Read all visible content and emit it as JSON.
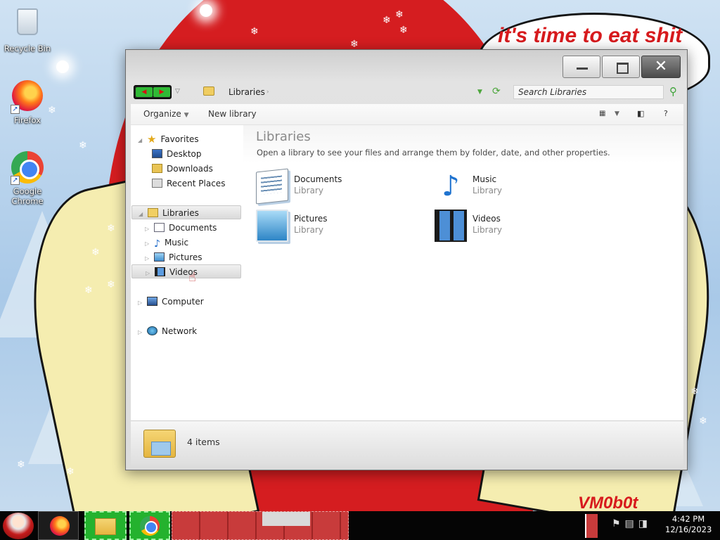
{
  "wallpaper": {
    "speech_bubble_text": "it's time to eat shit",
    "signature_text": "VM0b0t"
  },
  "desktop": {
    "icons": [
      {
        "label": "Recycle Bin",
        "icon": "recycle-bin-icon"
      },
      {
        "label": "Firefox",
        "icon": "firefox-icon"
      },
      {
        "label": "Google Chrome",
        "icon": "chrome-icon"
      }
    ]
  },
  "window": {
    "address": {
      "location": "Libraries",
      "search_placeholder": "Search Libraries"
    },
    "toolbar": {
      "organize_label": "Organize",
      "new_library_label": "New library",
      "help_label": "?"
    },
    "nav": {
      "favorites": {
        "label": "Favorites",
        "items": [
          "Desktop",
          "Downloads",
          "Recent Places"
        ]
      },
      "libraries": {
        "label": "Libraries",
        "items": [
          "Documents",
          "Music",
          "Pictures",
          "Videos"
        ]
      },
      "computer_label": "Computer",
      "network_label": "Network"
    },
    "content": {
      "title": "Libraries",
      "subtitle": "Open a library to see your files and arrange them by folder, date, and other properties.",
      "libraries": [
        {
          "name": "Documents",
          "type": "Library",
          "icon": "documents-library-icon"
        },
        {
          "name": "Music",
          "type": "Library",
          "icon": "music-library-icon"
        },
        {
          "name": "Pictures",
          "type": "Library",
          "icon": "pictures-library-icon"
        },
        {
          "name": "Videos",
          "type": "Library",
          "icon": "videos-library-icon"
        }
      ]
    },
    "details": {
      "item_count": "4 items"
    }
  },
  "taskbar": {
    "clock_time": "4:42 PM",
    "clock_date": "12/16/2023"
  },
  "colors": {
    "wallpaper_red": "#d51d20",
    "taskbar_green": "#24b22e",
    "bubble_text_red": "#d71a1d"
  }
}
